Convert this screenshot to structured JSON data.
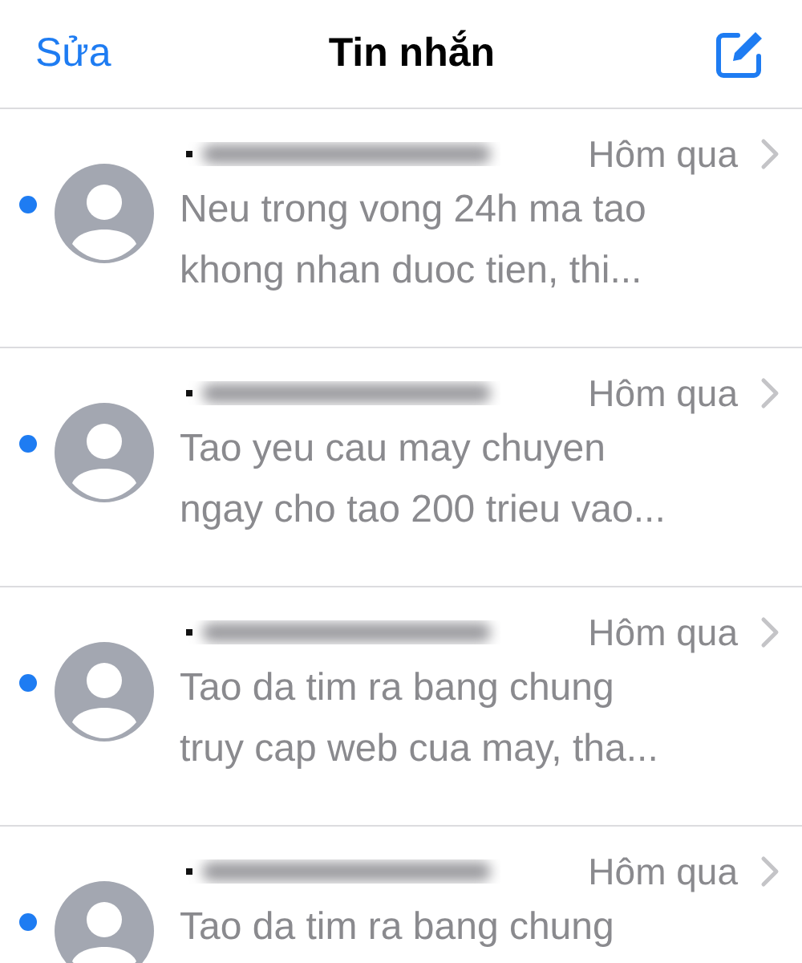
{
  "nav": {
    "edit": "Sửa",
    "title": "Tin nhắn"
  },
  "messages": [
    {
      "unread": true,
      "time": "Hôm qua",
      "preview": [
        "Neu trong vong 24h ma tao",
        "khong nhan duoc tien, thi..."
      ]
    },
    {
      "unread": true,
      "time": "Hôm qua",
      "preview": [
        "Tao yeu cau may chuyen",
        "ngay cho tao 200 trieu vao..."
      ]
    },
    {
      "unread": true,
      "time": "Hôm qua",
      "preview": [
        "Tao da tim ra bang chung",
        "truy cap web cua may, tha..."
      ]
    },
    {
      "unread": true,
      "time": "Hôm qua",
      "preview": [
        "Tao da tim ra bang chung"
      ]
    }
  ]
}
